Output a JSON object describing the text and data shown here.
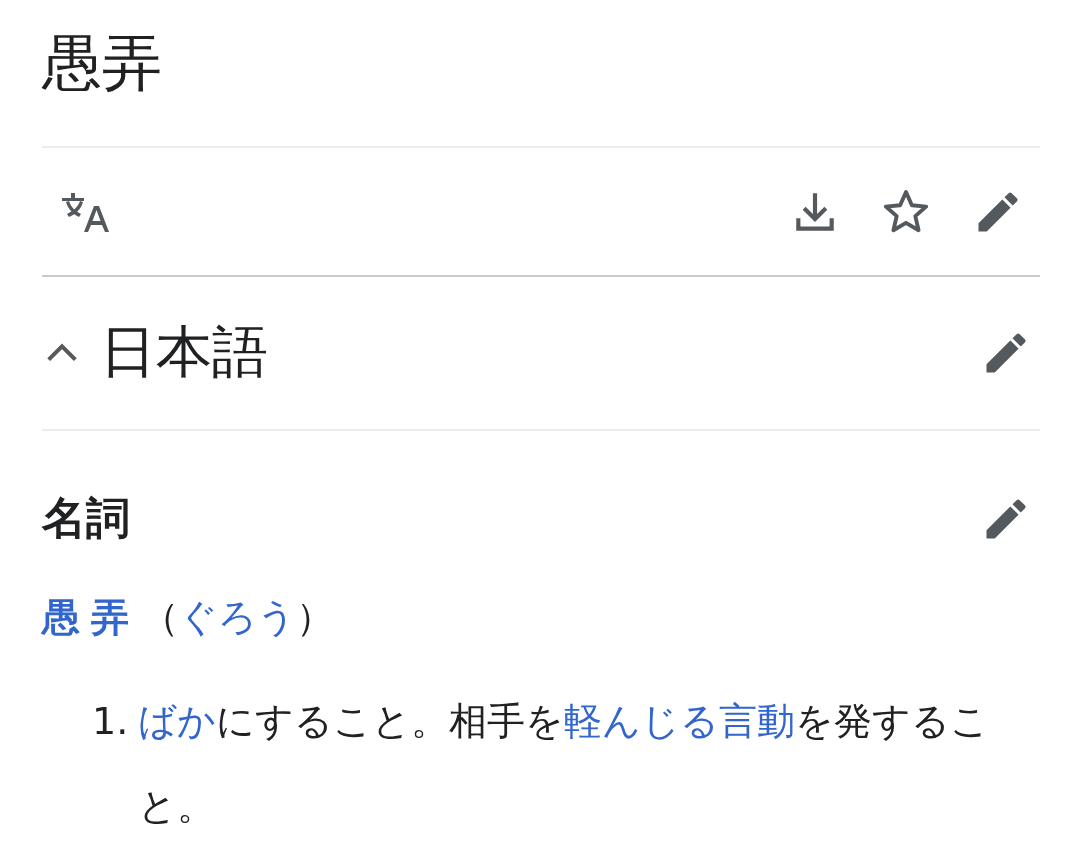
{
  "page": {
    "title": "愚弄"
  },
  "section": {
    "heading": "日本語",
    "expanded": true
  },
  "part_of_speech": "名詞",
  "headword": [
    {
      "kind": "link",
      "text": "愚弄",
      "bold": true
    },
    {
      "kind": "plain",
      "text": "（"
    },
    {
      "kind": "link",
      "text": "ぐろう"
    },
    {
      "kind": "plain",
      "text": "）"
    }
  ],
  "definitions": [
    {
      "number": "1.",
      "segments": [
        {
          "kind": "link",
          "text": "ばか"
        },
        {
          "kind": "plain",
          "text": "にすること。相手を"
        },
        {
          "kind": "link",
          "text": "軽んじる"
        },
        {
          "kind": "link",
          "text": "言動"
        },
        {
          "kind": "plain",
          "text": "を発すること。"
        }
      ]
    }
  ]
}
